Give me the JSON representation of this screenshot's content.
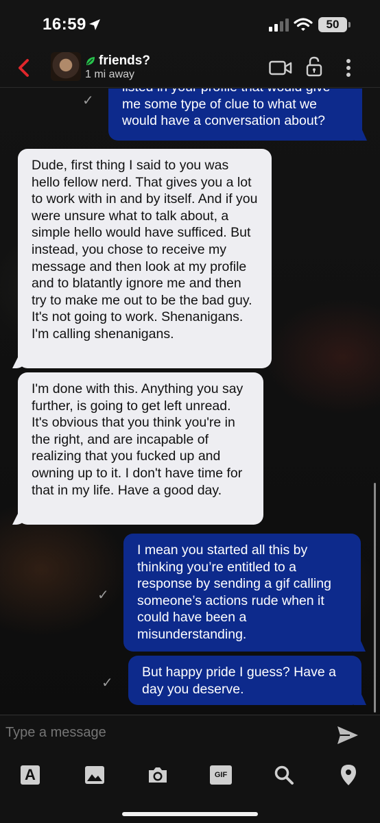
{
  "status_bar": {
    "time": "16:59",
    "battery": "50",
    "icons": [
      "location-arrow-icon",
      "signal-icon",
      "wifi-icon",
      "battery-icon"
    ]
  },
  "header": {
    "title": "friends?",
    "subtitle": "1 mi away",
    "accent": "#e0262b",
    "leaf_color": "#27c24c",
    "icons": [
      "back-chevron-icon",
      "avatar",
      "leaf-icon",
      "video-camera-icon",
      "lock-icon",
      "more-vertical-icon"
    ]
  },
  "messages": [
    {
      "direction": "outgoing",
      "text": "listed in your profile that would give me some type of clue to what we would have a conversation about?",
      "status": "✓"
    },
    {
      "direction": "incoming",
      "text": "Dude, first thing I said to you was hello fellow nerd. That gives you a lot to work with in and by itself. And if you were unsure what to talk about, a simple hello would have sufficed. But instead, you chose to receive my message and then look at my profile and to blatantly ignore me and then try to make me out to be the bad guy. It's not going to work. Shenanigans. I'm calling shenanigans."
    },
    {
      "direction": "incoming",
      "text": "I'm done with this. Anything you say further, is going to get left unread. It's obvious that you think you're in the right, and are incapable of realizing that you fucked up and owning up to it. I don't have time for that in my life. Have a good day."
    },
    {
      "direction": "outgoing",
      "text": "I mean you started all this by thinking you’re entitled to a response by sending a gif calling someone’s actions rude when it could have been a misunderstanding.",
      "status": "✓"
    },
    {
      "direction": "outgoing",
      "text": "But happy pride I guess? Have a day you deserve.",
      "status": "✓"
    }
  ],
  "colors": {
    "outgoing_bubble": "#0d2a8c",
    "incoming_bubble": "#eeeef2"
  },
  "composer": {
    "placeholder": "Type a message",
    "send_icon": "send-icon"
  },
  "toolbar": {
    "items": [
      {
        "icon": "text-format-icon",
        "glyph": "A"
      },
      {
        "icon": "image-gallery-icon"
      },
      {
        "icon": "camera-icon"
      },
      {
        "icon": "gif-icon",
        "glyph": "GIF"
      },
      {
        "icon": "search-icon"
      },
      {
        "icon": "location-pin-icon"
      }
    ]
  }
}
